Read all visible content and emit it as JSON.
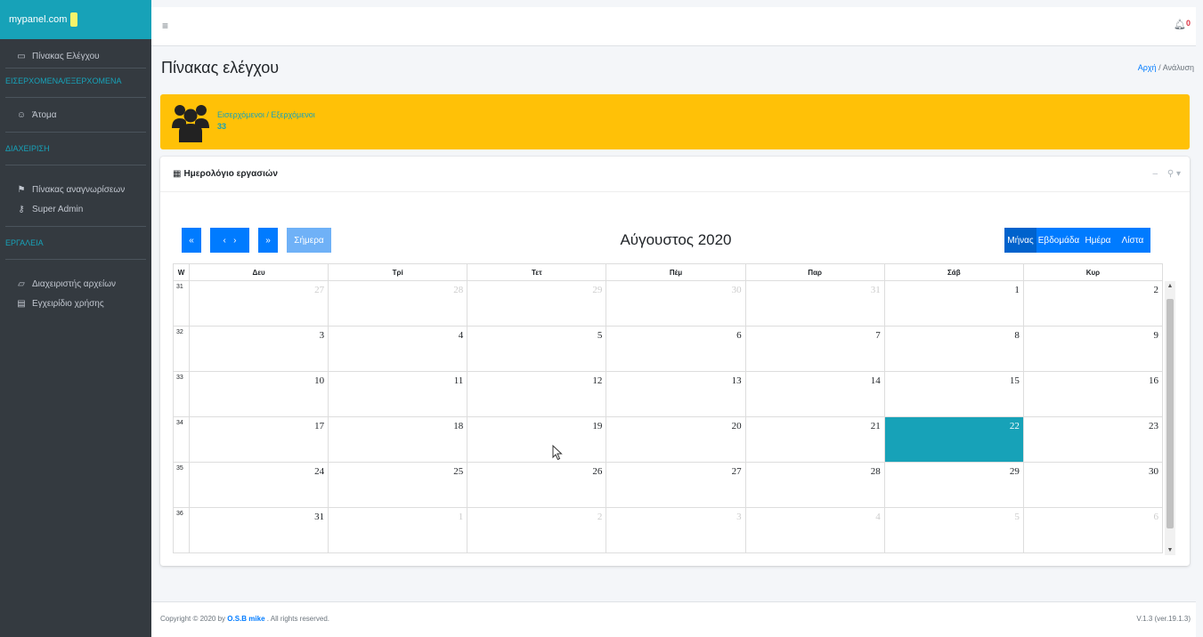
{
  "sidebar": {
    "brand": "mypanel.com",
    "items": [
      {
        "type": "item",
        "icon": "dashboard-icon",
        "label": "Πίνακας Ελέγχου"
      },
      {
        "type": "header",
        "label": "ΕΙΣΕΡΧΟΜΕΝΑ/ΕΞΕΡΧΟΜΕΝΑ"
      },
      {
        "type": "item",
        "icon": "user-icon",
        "label": "Άτομα"
      },
      {
        "type": "header",
        "label": "ΔΙΑΧΕΙΡΙΣΗ"
      },
      {
        "type": "item",
        "icon": "signpost-icon",
        "label": "Πίνακας αναγνωρίσεων"
      },
      {
        "type": "item",
        "icon": "key-icon",
        "label": "Super Admin"
      },
      {
        "type": "header",
        "label": "ΕΡΓΑΛΕΙΑ"
      },
      {
        "type": "item",
        "icon": "folder-icon",
        "label": "Διαχειριστής αρχείων"
      },
      {
        "type": "item",
        "icon": "file-icon",
        "label": "Εγχειρίδιο χρήσης"
      }
    ]
  },
  "header": {
    "notification_count": "0"
  },
  "page": {
    "title": "Πίνακας ελέγχου",
    "breadcrumb_home": "Αρχή",
    "breadcrumb_current": "Ανάλυση"
  },
  "infobox": {
    "label": "Εισερχόμενοι / Εξερχόμενοι",
    "value": "33"
  },
  "calendar_card": {
    "title": "Ημερολόγιο εργασιών",
    "month_title": "Αύγουστος 2020",
    "today_button": "Σήμερα",
    "views": [
      "Μήνας",
      "Εβδομάδα",
      "Ημέρα",
      "Λίστα"
    ],
    "active_view": "Μήνας",
    "week_header": "W",
    "day_headers": [
      "Δευ",
      "Τρί",
      "Τετ",
      "Πέμ",
      "Παρ",
      "Σάβ",
      "Κυρ"
    ],
    "weeks": [
      {
        "wk": "31",
        "days": [
          "27",
          "28",
          "29",
          "30",
          "31",
          "1",
          "2"
        ],
        "other": [
          true,
          true,
          true,
          true,
          true,
          false,
          false
        ]
      },
      {
        "wk": "32",
        "days": [
          "3",
          "4",
          "5",
          "6",
          "7",
          "8",
          "9"
        ],
        "other": [
          false,
          false,
          false,
          false,
          false,
          false,
          false
        ]
      },
      {
        "wk": "33",
        "days": [
          "10",
          "11",
          "12",
          "13",
          "14",
          "15",
          "16"
        ],
        "other": [
          false,
          false,
          false,
          false,
          false,
          false,
          false
        ]
      },
      {
        "wk": "34",
        "days": [
          "17",
          "18",
          "19",
          "20",
          "21",
          "22",
          "23"
        ],
        "other": [
          false,
          false,
          false,
          false,
          false,
          false,
          false
        ]
      },
      {
        "wk": "35",
        "days": [
          "24",
          "25",
          "26",
          "27",
          "28",
          "29",
          "30"
        ],
        "other": [
          false,
          false,
          false,
          false,
          false,
          false,
          false
        ]
      },
      {
        "wk": "36",
        "days": [
          "31",
          "1",
          "2",
          "3",
          "4",
          "5",
          "6"
        ],
        "other": [
          false,
          true,
          true,
          true,
          true,
          true,
          true
        ]
      }
    ],
    "today": "22"
  },
  "footer": {
    "copyright_prefix": "Copyright © 2020 by",
    "author": "O.S.B mike",
    "copyright_suffix": ". All rights reserved.",
    "version": "V.1.3 (ver.19.1.3)"
  },
  "colors": {
    "sidebar_bg": "#343a40",
    "brand_bg": "#17a2b8",
    "infobox_bg": "#ffc107",
    "primary": "#007bff",
    "today_bg": "#17a2b8"
  }
}
